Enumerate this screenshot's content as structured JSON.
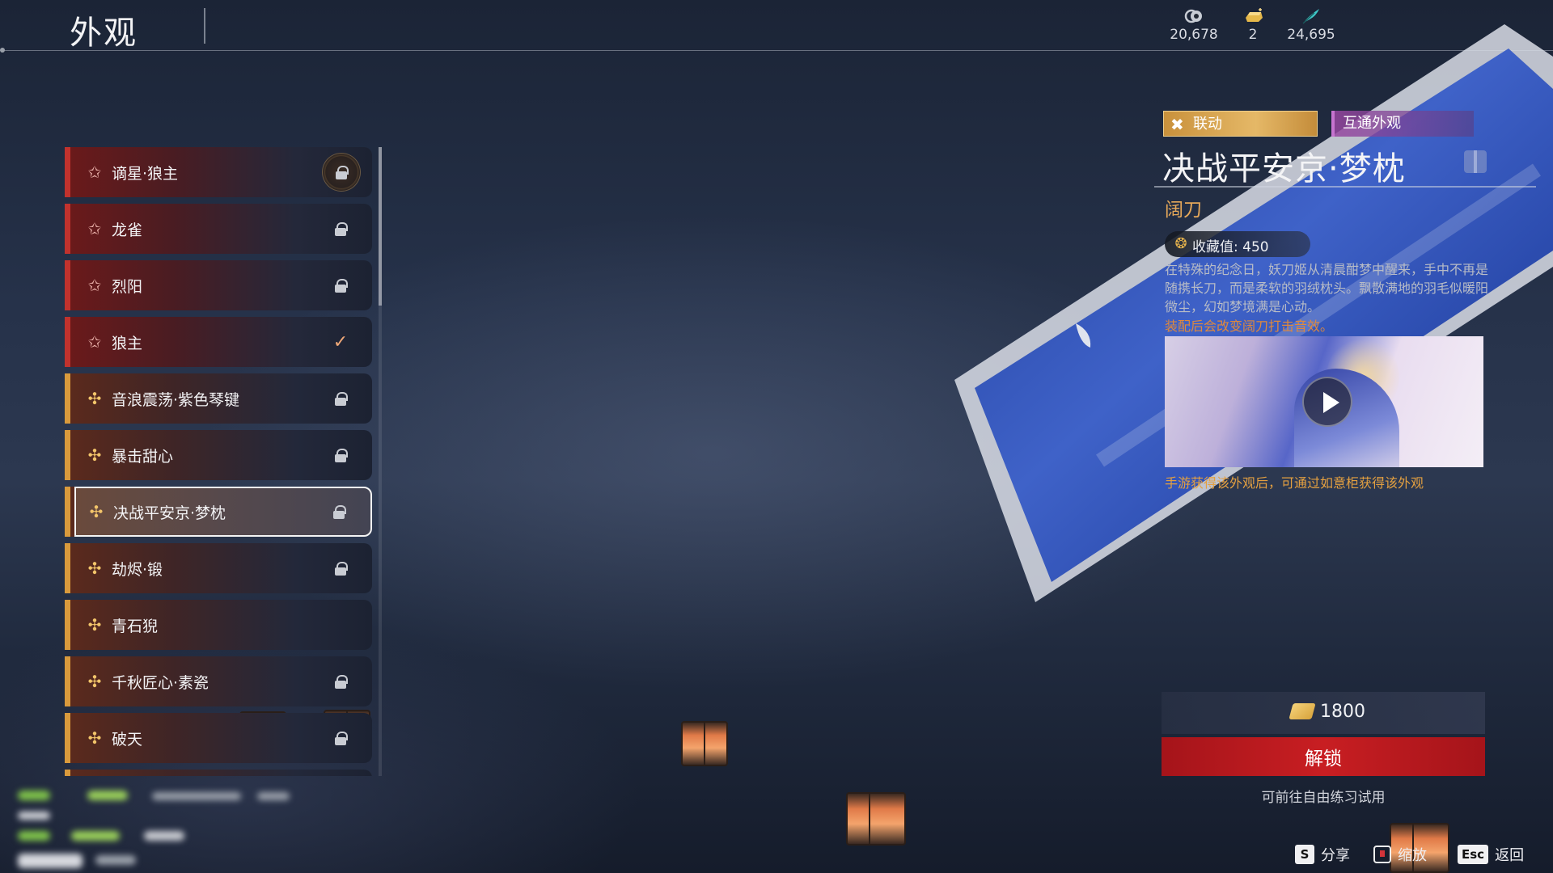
{
  "header": {
    "title": "外观",
    "currencies": [
      {
        "icon": "ticket-coin-icon",
        "value": "20,678",
        "color": "#c8ccd4"
      },
      {
        "icon": "gold-ingot-icon",
        "value": "2",
        "color": "#e6b84a"
      },
      {
        "icon": "feather-icon",
        "value": "24,695",
        "color": "#3fc9c9"
      }
    ]
  },
  "skin_list": {
    "items": [
      {
        "name": "谪星·狼主",
        "tier": "red",
        "status": "locked-badge"
      },
      {
        "name": "龙雀",
        "tier": "red",
        "status": "locked"
      },
      {
        "name": "烈阳",
        "tier": "red",
        "status": "locked"
      },
      {
        "name": "狼主",
        "tier": "red",
        "status": "equipped"
      },
      {
        "name": "音浪震荡·紫色琴键",
        "tier": "gold",
        "status": "locked"
      },
      {
        "name": "暴击甜心",
        "tier": "gold",
        "status": "locked"
      },
      {
        "name": "决战平安京·梦枕",
        "tier": "gold",
        "status": "locked",
        "selected": true
      },
      {
        "name": "劫烬·锻",
        "tier": "gold",
        "status": "locked"
      },
      {
        "name": "青石猊",
        "tier": "gold",
        "status": "none"
      },
      {
        "name": "千秋匠心·素瓷",
        "tier": "gold",
        "status": "locked"
      },
      {
        "name": "破天",
        "tier": "gold",
        "status": "locked"
      }
    ]
  },
  "detail": {
    "tag_collab": "联动",
    "tag_shared": "互通外观",
    "title": "决战平安京·梦枕",
    "weapon_type": "阔刀",
    "collection_label": "收藏值: 450",
    "description": "在特殊的纪念日，妖刀姬从清晨酣梦中醒来，手中不再是随携长刀，而是柔软的羽绒枕头。飘散满地的羽毛似暖阳微尘，幻如梦境满是心动。",
    "effect_note": "装配后会改变阔刀打击音效。",
    "obtain_note": "手游获得该外观后，可通过如意柜获得该外观"
  },
  "purchase": {
    "price": "1800",
    "unlock_label": "解锁",
    "practice_note": "可前往自由练习试用"
  },
  "hotkeys": [
    {
      "key": "S",
      "label": "分享"
    },
    {
      "key": "",
      "label": "缩放"
    },
    {
      "key": "Esc",
      "label": "返回"
    }
  ]
}
